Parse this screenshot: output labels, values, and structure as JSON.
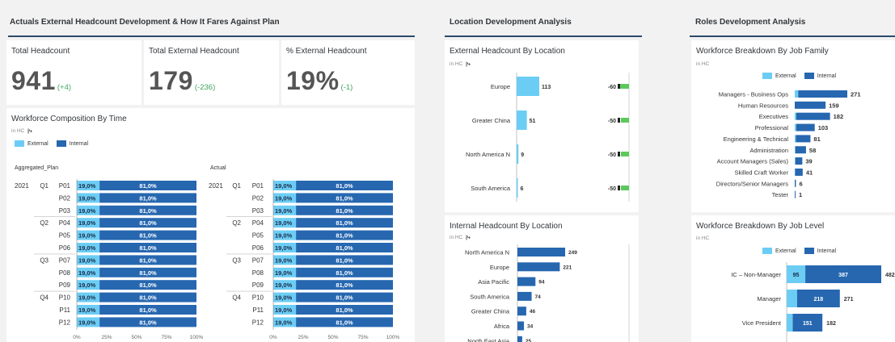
{
  "sections": {
    "actuals": "Actuals External Headcount Development & How It Fares Against Plan",
    "location": "Location Development Analysis",
    "roles": "Roles Development Analysis"
  },
  "kpis": [
    {
      "title": "Total Headcount",
      "value": "941",
      "delta": "(+4)"
    },
    {
      "title": "Total External Headcount",
      "value": "179",
      "delta": "(-236)"
    },
    {
      "title": "% External Headcount",
      "value": "19%",
      "delta": "(-1)"
    }
  ],
  "unit": "in HC",
  "legend": {
    "external": "External",
    "internal": "Internal"
  },
  "colors": {
    "external": "#6ccdf4",
    "internal": "#2667b0",
    "delta_bar": "#5cc85c",
    "kpi_delta": "#3fa75f"
  },
  "composition": {
    "title": "Workforce Composition By Time",
    "left_label": "Aggregated_Plan",
    "right_label": "Actual",
    "year": "2021",
    "quarters": [
      "Q1",
      "Q2",
      "Q3",
      "Q4"
    ],
    "periods": [
      "P01",
      "P02",
      "P03",
      "P04",
      "P05",
      "P06",
      "P07",
      "P08",
      "P09",
      "P10",
      "P11",
      "P12"
    ],
    "external_pct": [
      "19,0%",
      "19,0%",
      "19,0%",
      "19,0%",
      "19,0%",
      "19,0%",
      "19,0%",
      "19,0%",
      "19,0%",
      "19,0%",
      "19,0%",
      "19,0%"
    ],
    "internal_pct": [
      "81,0%",
      "81,0%",
      "81,0%",
      "81,0%",
      "81,0%",
      "81,0%",
      "81,0%",
      "81,0%",
      "81,0%",
      "81,0%",
      "81,0%",
      "81,0%"
    ],
    "axis_ticks": [
      "0%",
      "25%",
      "50%",
      "75%",
      "100%"
    ]
  },
  "chart_data": [
    {
      "type": "bar",
      "title": "External Headcount By Location",
      "categories": [
        "Europe",
        "Greater China",
        "North America N",
        "South America"
      ],
      "values": [
        113,
        51,
        9,
        6
      ],
      "deltas": [
        -60,
        -50,
        -50,
        -50
      ]
    },
    {
      "type": "bar",
      "title": "Internal Headcount By Location",
      "categories": [
        "North America N",
        "Europe",
        "Asia Pacific",
        "South America",
        "Greater China",
        "Africa",
        "North East Asia"
      ],
      "values": [
        249,
        221,
        94,
        74,
        46,
        34,
        25
      ]
    },
    {
      "type": "bar",
      "title": "Workforce Breakdown By Job Family",
      "categories": [
        "Managers - Business Ops",
        "Human Resources",
        "Executives",
        "Professional",
        "Engineering & Technical",
        "Administration",
        "Account Managers (Sales)",
        "Skilled Craft Worker",
        "Directors/Senior Managers",
        "Tester"
      ],
      "series": [
        {
          "name": "External",
          "values": [
            18,
            0,
            8,
            8,
            6,
            3,
            3,
            2,
            0,
            0
          ]
        },
        {
          "name": "Internal",
          "values": [
            253,
            159,
            174,
            95,
            75,
            55,
            36,
            39,
            6,
            1
          ]
        }
      ],
      "totals": [
        271,
        159,
        182,
        103,
        81,
        58,
        39,
        41,
        6,
        1
      ]
    },
    {
      "type": "bar",
      "title": "Workforce Breakdown By Job Level",
      "categories": [
        "IC – Non-Manager",
        "Manager",
        "Vice President"
      ],
      "series": [
        {
          "name": "External",
          "values": [
            95,
            53,
            31
          ]
        },
        {
          "name": "Internal",
          "values": [
            387,
            218,
            151
          ]
        }
      ],
      "totals": [
        482,
        271,
        182
      ]
    }
  ]
}
